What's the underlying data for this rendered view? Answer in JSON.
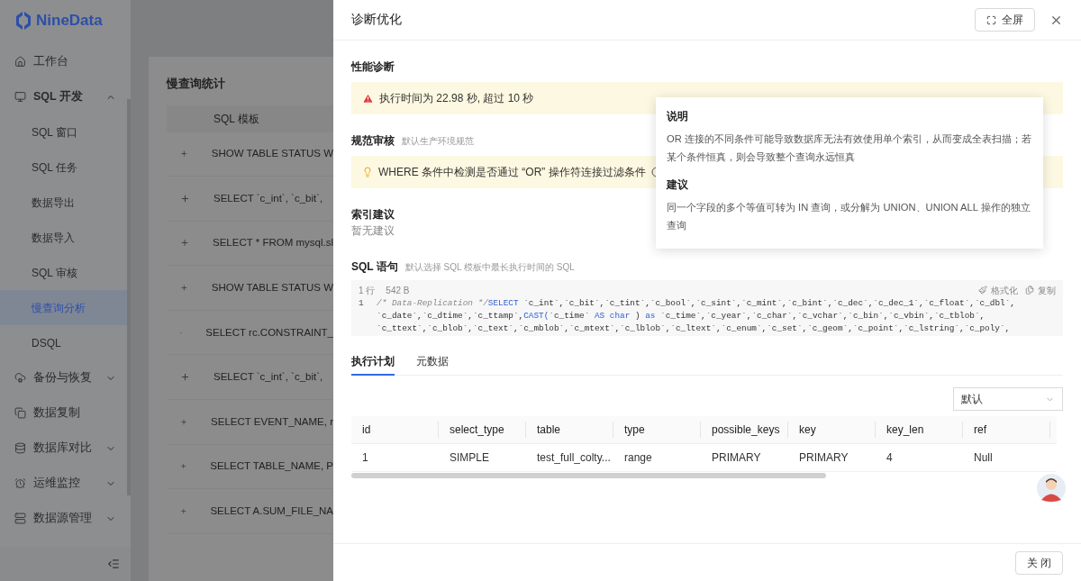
{
  "brand": {
    "name": "NineData"
  },
  "sidebar": {
    "items": [
      {
        "label": "工作台"
      },
      {
        "label": "SQL 开发",
        "expanded": true,
        "children": [
          {
            "label": "SQL 窗口",
            "selected": false
          },
          {
            "label": "SQL 任务",
            "selected": false
          },
          {
            "label": "数据导出",
            "selected": false
          },
          {
            "label": "数据导入",
            "selected": false
          },
          {
            "label": "SQL 审核",
            "selected": false
          },
          {
            "label": "慢查询分析",
            "selected": true
          },
          {
            "label": "DSQL",
            "selected": false
          }
        ]
      },
      {
        "label": "备份与恢复",
        "expanded": false
      },
      {
        "label": "数据复制"
      },
      {
        "label": "数据库对比",
        "expanded": false
      },
      {
        "label": "运维监控",
        "expanded": false
      },
      {
        "label": "数据源管理",
        "expanded": false
      }
    ]
  },
  "slow_query": {
    "title": "慢查询统计",
    "column": "SQL 模板",
    "rows": [
      "SHOW TABLE STATUS W",
      "SELECT `c_int`, `c_bit`,",
      "SELECT * FROM mysql.sl",
      "SHOW TABLE STATUS W",
      "SELECT rc.CONSTRAINT_",
      "SELECT `c_int`, `c_bit`,",
      "SELECT EVENT_NAME, r",
      "SELECT TABLE_NAME, P",
      "SELECT A.SUM_FILE_NA"
    ]
  },
  "drawer": {
    "title": "诊断优化",
    "fullscreen_button": "全屏",
    "performance": {
      "title": "性能诊断",
      "alert": "执行时间为 22.98 秒, 超过 10 秒"
    },
    "review": {
      "title": "规范审核",
      "subtitle": "默认生产环境规范",
      "rule": "WHERE 条件中检测是否通过 “OR” 操作符连接过滤条件"
    },
    "tooltip": {
      "sections": [
        {
          "heading": "说明",
          "text": "OR 连接的不同条件可能导致数据库无法有效使用单个索引，从而变成全表扫描；若某个条件恒真，则会导致整个查询永远恒真"
        },
        {
          "heading": "建议",
          "text": "同一个字段的多个等值可转为 IN 查询，或分解为 UNION、UNION ALL 操作的独立查询"
        }
      ]
    },
    "index": {
      "title": "索引建议",
      "text": "暂无建议"
    },
    "sql": {
      "title": "SQL 语句",
      "subtitle": "默认选择 SQL 模板中最长执行时间的 SQL",
      "meta": [
        "1 行",
        "542 B"
      ],
      "actions": [
        "格式化",
        "复制"
      ],
      "line_number": "1",
      "lines": [
        [
          {
            "kind": "comment",
            "text": "/* Data-Replication */"
          },
          {
            "kind": "keyword",
            "text": "SELECT"
          },
          {
            "kind": "plain",
            "text": " `c_int`,`c_bit`,`c_tint`,`c_bool`,`c_sint`,`c_mint`,`c_bint`,`c_dec`,`c_dec_1`,`c_float`,`c_dbl`,"
          }
        ],
        [
          {
            "kind": "plain",
            "text": "`c_date`,`c_dtime`,`c_ttamp`,"
          },
          {
            "kind": "keyword",
            "text": "CAST("
          },
          {
            "kind": "plain",
            "text": "`c_time` "
          },
          {
            "kind": "keyword",
            "text": "AS char"
          },
          {
            "kind": "plain",
            "text": " ) "
          },
          {
            "kind": "keyword",
            "text": "as"
          },
          {
            "kind": "plain",
            "text": " `c_time`,`c_year`,`c_char`,`c_vchar`,`c_bin`,`c_vbin`,`c_tblob`,"
          }
        ],
        [
          {
            "kind": "plain",
            "text": "`c_ttext`,`c_blob`,`c_text`,`c_mblob`,`c_mtext`,`c_lblob`,`c_ltext`,`c_enum`,`c_set`,`c_geom`,`c_point`,`c_lstring`,`c_poly`,"
          }
        ]
      ]
    },
    "tabs": [
      {
        "label": "执行计划",
        "selected": true
      },
      {
        "label": "元数据",
        "selected": false
      }
    ],
    "select": {
      "value": "默认"
    },
    "plan": {
      "columns": [
        "id",
        "select_type",
        "table",
        "type",
        "possible_keys",
        "key",
        "key_len",
        "ref"
      ],
      "rows": [
        [
          "1",
          "SIMPLE",
          "test_full_colty...",
          "range",
          "PRIMARY",
          "PRIMARY",
          "4",
          "Null"
        ]
      ]
    },
    "close_button": "关 闭"
  }
}
